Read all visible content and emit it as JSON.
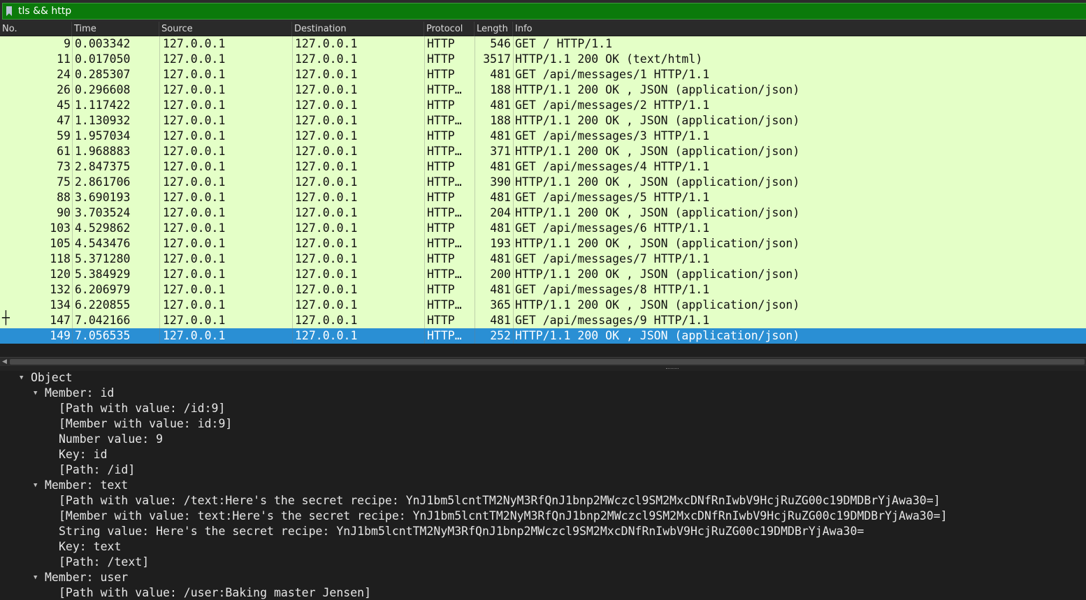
{
  "filter": {
    "value": "tls && http",
    "icon": "bookmark-icon"
  },
  "columns": [
    "No.",
    "Time",
    "Source",
    "Destination",
    "Protocol",
    "Length",
    "Info"
  ],
  "packets": [
    {
      "no": "9",
      "time": "0.003342",
      "src": "127.0.0.1",
      "dst": "127.0.0.1",
      "proto": "HTTP",
      "len": "546",
      "info": "GET / HTTP/1.1"
    },
    {
      "no": "11",
      "time": "0.017050",
      "src": "127.0.0.1",
      "dst": "127.0.0.1",
      "proto": "HTTP",
      "len": "3517",
      "info": "HTTP/1.1 200 OK  (text/html)"
    },
    {
      "no": "24",
      "time": "0.285307",
      "src": "127.0.0.1",
      "dst": "127.0.0.1",
      "proto": "HTTP",
      "len": "481",
      "info": "GET /api/messages/1 HTTP/1.1"
    },
    {
      "no": "26",
      "time": "0.296608",
      "src": "127.0.0.1",
      "dst": "127.0.0.1",
      "proto": "HTTP…",
      "len": "188",
      "info": "HTTP/1.1 200 OK , JSON (application/json)"
    },
    {
      "no": "45",
      "time": "1.117422",
      "src": "127.0.0.1",
      "dst": "127.0.0.1",
      "proto": "HTTP",
      "len": "481",
      "info": "GET /api/messages/2 HTTP/1.1"
    },
    {
      "no": "47",
      "time": "1.130932",
      "src": "127.0.0.1",
      "dst": "127.0.0.1",
      "proto": "HTTP…",
      "len": "188",
      "info": "HTTP/1.1 200 OK , JSON (application/json)"
    },
    {
      "no": "59",
      "time": "1.957034",
      "src": "127.0.0.1",
      "dst": "127.0.0.1",
      "proto": "HTTP",
      "len": "481",
      "info": "GET /api/messages/3 HTTP/1.1"
    },
    {
      "no": "61",
      "time": "1.968883",
      "src": "127.0.0.1",
      "dst": "127.0.0.1",
      "proto": "HTTP…",
      "len": "371",
      "info": "HTTP/1.1 200 OK , JSON (application/json)"
    },
    {
      "no": "73",
      "time": "2.847375",
      "src": "127.0.0.1",
      "dst": "127.0.0.1",
      "proto": "HTTP",
      "len": "481",
      "info": "GET /api/messages/4 HTTP/1.1"
    },
    {
      "no": "75",
      "time": "2.861706",
      "src": "127.0.0.1",
      "dst": "127.0.0.1",
      "proto": "HTTP…",
      "len": "390",
      "info": "HTTP/1.1 200 OK , JSON (application/json)"
    },
    {
      "no": "88",
      "time": "3.690193",
      "src": "127.0.0.1",
      "dst": "127.0.0.1",
      "proto": "HTTP",
      "len": "481",
      "info": "GET /api/messages/5 HTTP/1.1"
    },
    {
      "no": "90",
      "time": "3.703524",
      "src": "127.0.0.1",
      "dst": "127.0.0.1",
      "proto": "HTTP…",
      "len": "204",
      "info": "HTTP/1.1 200 OK , JSON (application/json)"
    },
    {
      "no": "103",
      "time": "4.529862",
      "src": "127.0.0.1",
      "dst": "127.0.0.1",
      "proto": "HTTP",
      "len": "481",
      "info": "GET /api/messages/6 HTTP/1.1"
    },
    {
      "no": "105",
      "time": "4.543476",
      "src": "127.0.0.1",
      "dst": "127.0.0.1",
      "proto": "HTTP…",
      "len": "193",
      "info": "HTTP/1.1 200 OK , JSON (application/json)"
    },
    {
      "no": "118",
      "time": "5.371280",
      "src": "127.0.0.1",
      "dst": "127.0.0.1",
      "proto": "HTTP",
      "len": "481",
      "info": "GET /api/messages/7 HTTP/1.1"
    },
    {
      "no": "120",
      "time": "5.384929",
      "src": "127.0.0.1",
      "dst": "127.0.0.1",
      "proto": "HTTP…",
      "len": "200",
      "info": "HTTP/1.1 200 OK , JSON (application/json)"
    },
    {
      "no": "132",
      "time": "6.206979",
      "src": "127.0.0.1",
      "dst": "127.0.0.1",
      "proto": "HTTP",
      "len": "481",
      "info": "GET /api/messages/8 HTTP/1.1"
    },
    {
      "no": "134",
      "time": "6.220855",
      "src": "127.0.0.1",
      "dst": "127.0.0.1",
      "proto": "HTTP…",
      "len": "365",
      "info": "HTTP/1.1 200 OK , JSON (application/json)"
    },
    {
      "no": "147",
      "time": "7.042166",
      "src": "127.0.0.1",
      "dst": "127.0.0.1",
      "proto": "HTTP",
      "len": "481",
      "info": "GET /api/messages/9 HTTP/1.1"
    },
    {
      "no": "149",
      "time": "7.056535",
      "src": "127.0.0.1",
      "dst": "127.0.0.1",
      "proto": "HTTP…",
      "len": "252",
      "info": "HTTP/1.1 200 OK , JSON (application/json)"
    }
  ],
  "selected_packet": "149",
  "colors": {
    "row_bg": "#e4ffc7",
    "selected_bg": "#2a8fd4",
    "filter_bg": "#0b7a0b"
  },
  "detail_tree": [
    {
      "level": 0,
      "expanded": true,
      "text": "Object"
    },
    {
      "level": 1,
      "expanded": true,
      "text": "Member: id"
    },
    {
      "level": 2,
      "text": "[Path with value: /id:9]"
    },
    {
      "level": 2,
      "text": "[Member with value: id:9]"
    },
    {
      "level": 2,
      "text": "Number value: 9"
    },
    {
      "level": 2,
      "text": "Key: id"
    },
    {
      "level": 2,
      "text": "[Path: /id]"
    },
    {
      "level": 1,
      "expanded": true,
      "text": "Member: text"
    },
    {
      "level": 2,
      "text": "[Path with value: /text:Here's the secret recipe: YnJ1bm5lcntTM2NyM3RfQnJ1bnp2MWczcl9SM2MxcDNfRnIwbV9HcjRuZG00c19DMDBrYjAwa30=]"
    },
    {
      "level": 2,
      "text": "[Member with value: text:Here's the secret recipe: YnJ1bm5lcntTM2NyM3RfQnJ1bnp2MWczcl9SM2MxcDNfRnIwbV9HcjRuZG00c19DMDBrYjAwa30=]"
    },
    {
      "level": 2,
      "text": "String value: Here's the secret recipe: YnJ1bm5lcntTM2NyM3RfQnJ1bnp2MWczcl9SM2MxcDNfRnIwbV9HcjRuZG00c19DMDBrYjAwa30="
    },
    {
      "level": 2,
      "text": "Key: text"
    },
    {
      "level": 2,
      "text": "[Path: /text]"
    },
    {
      "level": 1,
      "expanded": true,
      "text": "Member: user"
    },
    {
      "level": 2,
      "text": "[Path with value: /user:Baking master Jensen]"
    }
  ]
}
